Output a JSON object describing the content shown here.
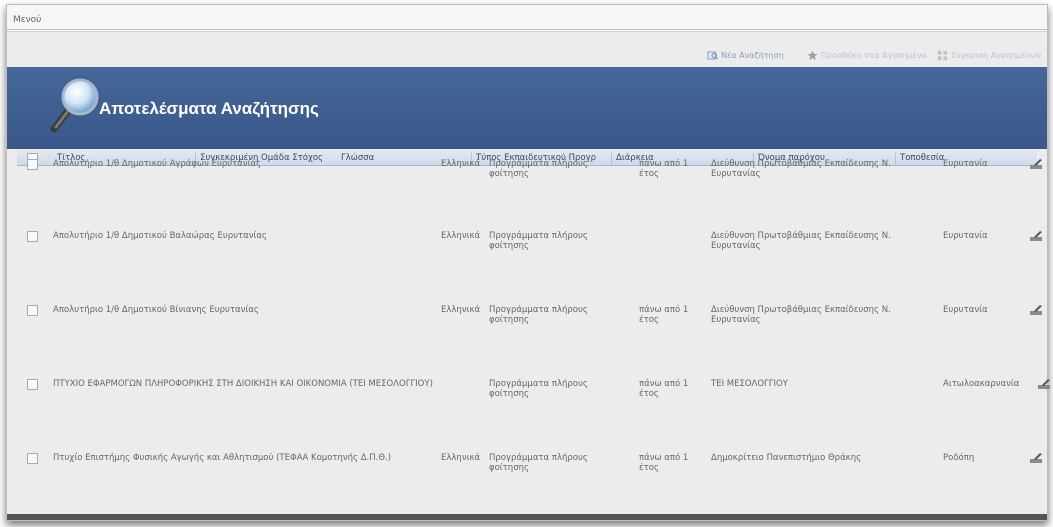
{
  "menu": {
    "label": "Μενού"
  },
  "toolbar": {
    "new_search": "Νέα Αναζήτηση",
    "add_favorites": "Προσθήκη στα Αγαπημένα",
    "compare": "Σύγκριση Αγαπημένων"
  },
  "banner": {
    "title": "Αποτελέσματα Αναζήτησης"
  },
  "columns": {
    "title": "Τίτλος",
    "target_group": "Συγκεκριμένη Ομάδα Στόχος",
    "language": "Γλώσσα",
    "edu_type": "Τύπος Εκπαιδευτικού Προγρ",
    "duration": "Διάρκεια",
    "provider": "Όνομα παρόχου",
    "location": "Τοποθεσία"
  },
  "rows": [
    {
      "title": "Απολυτήριο 1/θ Δημοτικού Αγράφων Ευρυτανίας",
      "language": "Ελληνικά",
      "edu_type": "Προγράμματα πλήρους φοίτησης",
      "duration": "πάνω από 1 έτος",
      "provider": "Διεύθυνση Πρωτοβάθμιας Εκπαίδευσης Ν. Ευρυτανίας",
      "location": "Ευρυτανία"
    },
    {
      "title": "Απολυτήριο 1/θ Δημοτικού Βαλαώρας Ευρυτανίας",
      "language": "Ελληνικά",
      "edu_type": "Προγράμματα πλήρους φοίτησης",
      "duration": "",
      "provider": "Διεύθυνση Πρωτοβάθμιας Εκπαίδευσης Ν. Ευρυτανίας",
      "location": "Ευρυτανία"
    },
    {
      "title": "Απολυτήριο 1/θ Δημοτικού Βίνιανης Ευρυτανίας",
      "language": "Ελληνικά",
      "edu_type": "Προγράμματα πλήρους φοίτησης",
      "duration": "πάνω από 1 έτος",
      "provider": "Διεύθυνση Πρωτοβάθμιας Εκπαίδευσης Ν. Ευρυτανίας",
      "location": "Ευρυτανία"
    },
    {
      "title": "ΠΤΥΧΙΟ ΕΦΑΡΜΟΓΩΝ ΠΛΗΡΟΦΟΡΙΚΗΣ ΣΤΗ ΔΙΟΙΚΗΣΗ ΚΑΙ ΟΙΚΟΝΟΜΙΑ (ΤΕΙ ΜΕΣΟΛΟΓΓΙΟΥ)",
      "language": "",
      "edu_type": "Προγράμματα πλήρους φοίτησης",
      "duration": "πάνω από 1 έτος",
      "provider": "ΤΕΙ ΜΕΣΟΛΟΓΓΙΟΥ",
      "location": "Αιτωλοακαρνανία"
    },
    {
      "title": "Πτυχίο Επιστήμης Φυσικής Αγωγής και Αθλητισμού (ΤΕΦΑΑ Κομοτηνής Δ.Π.Θ.)",
      "language": "Ελληνικά",
      "edu_type": "Προγράμματα πλήρους φοίτησης",
      "duration": "πάνω από 1 έτος",
      "provider": "Δημοκρίτειο Πανεπιστήμιο Θράκης",
      "location": "Ροδόπη"
    }
  ]
}
